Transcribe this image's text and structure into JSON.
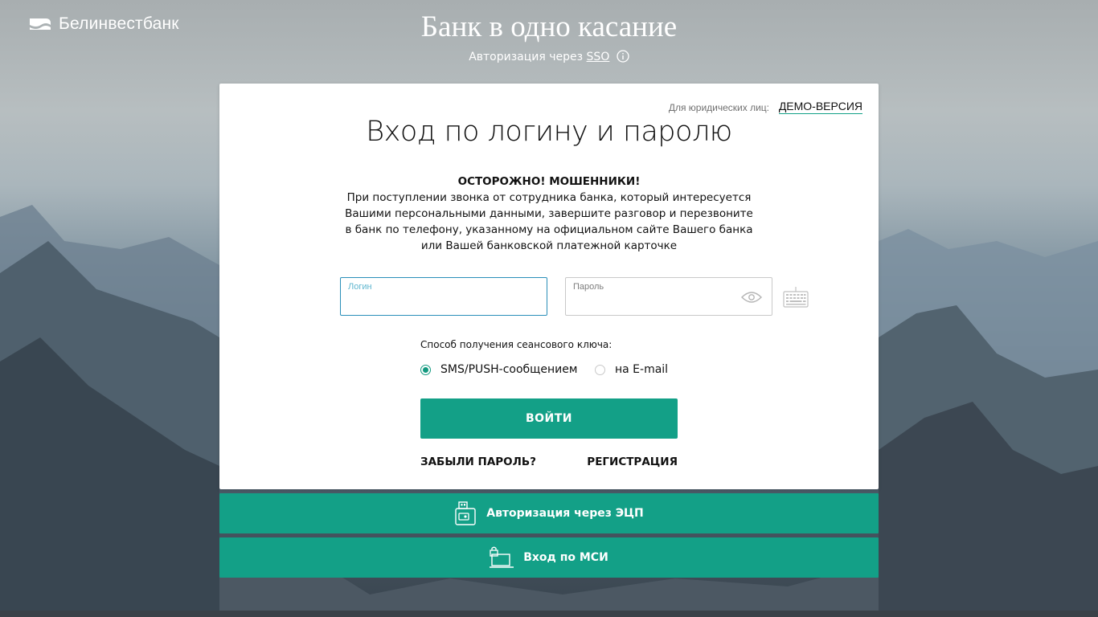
{
  "brand": {
    "name": "Белинвестбанк",
    "icon": "belinvestbank-logo-icon"
  },
  "hero": {
    "title": "Банк в одно касание",
    "sso_prefix": "Авторизация через",
    "sso_link": "SSO",
    "info_icon": "info-icon"
  },
  "card": {
    "legal_label": "Для юридических лиц:",
    "demo_link": "ДЕМО-ВЕРСИЯ",
    "title": "Вход по логину и паролю",
    "warning": {
      "title": "ОСТОРОЖНО! МОШЕННИКИ!",
      "lines": [
        "При поступлении звонка от сотрудника банка, который интересуется",
        "Вашими персональными данными, завершите разговор и перезвоните",
        "в банк по телефону, указанному на официальном сайте Вашего банка",
        "или Вашей банковской платежной карточке"
      ]
    },
    "login": {
      "label": "Логин",
      "value": ""
    },
    "password": {
      "label": "Пароль",
      "value": "",
      "toggle_icon": "eye-icon"
    },
    "virtual_keyboard_icon": "keyboard-icon",
    "session_key": {
      "label": "Способ получения сеансового ключа:",
      "options": [
        {
          "label": "SMS/PUSH-сообщением",
          "checked": true
        },
        {
          "label": "на E-mail",
          "checked": false
        }
      ]
    },
    "submit_label": "ВОЙТИ",
    "forgot_label": "ЗАБЫЛИ ПАРОЛЬ?",
    "register_label": "РЕГИСТРАЦИЯ"
  },
  "alt_auth": {
    "ecp_label": "Авторизация через ЭЦП",
    "ecp_icon": "usb-token-icon",
    "msi_label": "Вход по МСИ",
    "msi_icon": "laptop-lock-icon"
  },
  "colors": {
    "accent": "#13a087",
    "focus_border": "#2a8fb9",
    "text": "#111111"
  }
}
